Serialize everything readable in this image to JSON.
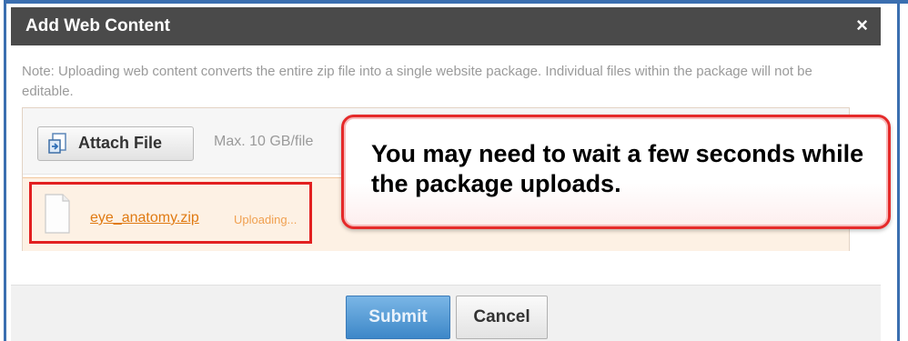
{
  "dialog": {
    "title": "Add Web Content",
    "close_glyph": "×",
    "note": "Note: Uploading web content converts the entire zip file into a single website package. Individual files within the package will not be editable."
  },
  "upload": {
    "attach_label": "Attach File",
    "attach_icon": "attach-file-icon",
    "max_size": "Max. 10 GB/file",
    "file": {
      "name": "eye_anatomy.zip",
      "status": "Uploading...",
      "icon": "file-icon"
    }
  },
  "callout": {
    "text": "You may need to wait a few seconds while the package uploads."
  },
  "footer": {
    "submit_label": "Submit",
    "cancel_label": "Cancel"
  },
  "colors": {
    "titlebar": "#4a4a4a",
    "accent_blue": "#3d87c8",
    "highlight_red": "#e22020",
    "file_link": "#e07a12"
  }
}
